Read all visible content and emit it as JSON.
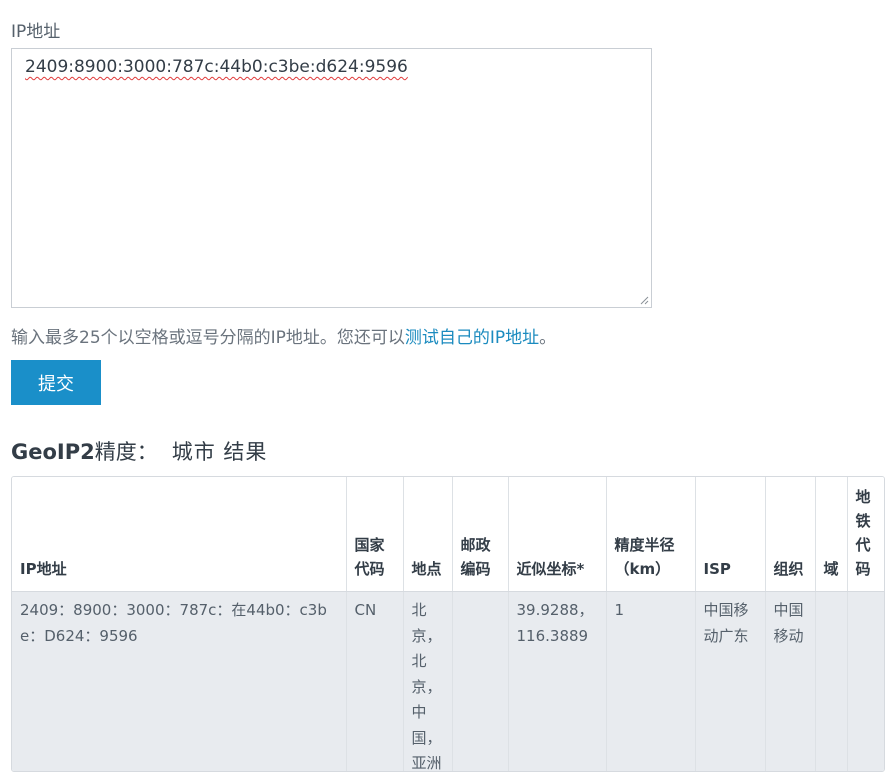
{
  "form": {
    "label": "IP地址",
    "textarea_value": "2409:8900:3000:787c:44b0:c3be:d624:9596",
    "helper_text": "输入最多25个以空格或逗号分隔的IP地址。您还可以",
    "helper_link": "测试自己的IP地址",
    "helper_end": "。",
    "submit_label": "提交"
  },
  "results": {
    "title_bold": "GeoIP2",
    "title_rest": "精度：",
    "title_suffix": "城市 结果"
  },
  "table": {
    "headers": {
      "ip": "IP地址",
      "country": "国家代码",
      "location": "地点",
      "postal": "邮政编码",
      "coords": "近似坐标*",
      "radius": "精度半径（km）",
      "isp": "ISP",
      "org": "组织",
      "domain": "域",
      "metro": "地铁代码"
    },
    "rows": [
      {
        "ip": "2409：8900：3000：787c：在44b0：c3be：D624：9596",
        "country": "CN",
        "location": "北京，北京，中国，亚洲",
        "postal": "",
        "coords": "39.9288，116.3889",
        "radius": "1",
        "isp": "中国移动广东",
        "org": "中国移动",
        "domain": "",
        "metro": ""
      }
    ]
  }
}
